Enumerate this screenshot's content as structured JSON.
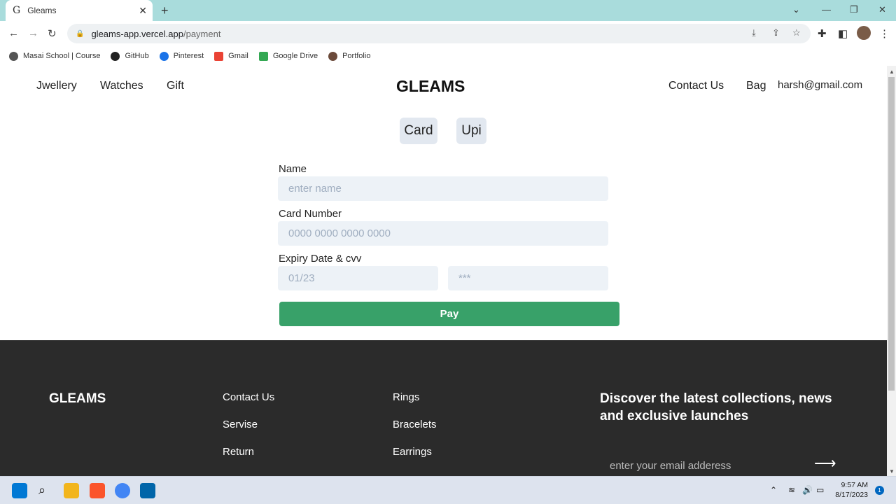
{
  "browser": {
    "tab_title": "Gleams",
    "tab_favicon": "G",
    "url_host": "gleams-app.vercel.app",
    "url_path": "/payment",
    "bookmarks": [
      {
        "label": "Masai School | Course",
        "icon": "globe-icon"
      },
      {
        "label": "GitHub",
        "icon": "github-icon"
      },
      {
        "label": "Pinterest",
        "icon": "pinterest-icon"
      },
      {
        "label": "Gmail",
        "icon": "gmail-icon"
      },
      {
        "label": "Google Drive",
        "icon": "drive-icon"
      },
      {
        "label": "Portfolio",
        "icon": "portfolio-icon"
      }
    ]
  },
  "header": {
    "nav": [
      "Jwellery",
      "Watches",
      "Gift"
    ],
    "logo": "GLEAMS",
    "contact": "Contact Us",
    "bag": "Bag",
    "user_email": "harsh@gmail.com"
  },
  "payment": {
    "methods": [
      "Card",
      "Upi"
    ],
    "name_label": "Name",
    "name_placeholder": "enter name",
    "card_label": "Card Number",
    "card_placeholder": "0000 0000 0000 0000",
    "expiry_label": "Expiry Date & cvv",
    "expiry_placeholder": "01/23",
    "cvv_placeholder": "***",
    "pay_label": "Pay",
    "pay_color": "#38a169"
  },
  "footer": {
    "logo": "GLEAMS",
    "col1": [
      "Contact Us",
      "Servise",
      "Return"
    ],
    "col2": [
      "Rings",
      "Bracelets",
      "Earrings"
    ],
    "discover": "Discover the latest collections, news and exclusive launches",
    "email_placeholder": "enter your email adderess",
    "bg_color": "#2b2b2b"
  },
  "taskbar": {
    "time": "9:57 AM",
    "date": "8/17/2023",
    "notifications": "1"
  }
}
